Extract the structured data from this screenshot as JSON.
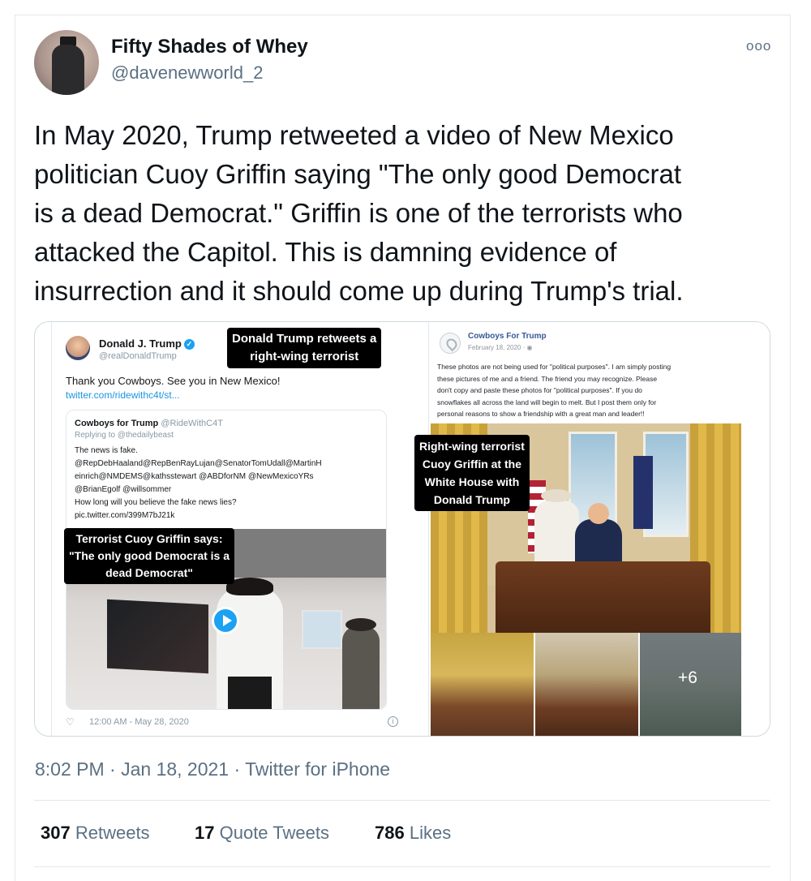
{
  "tweet": {
    "author": {
      "display_name": "Fifty Shades of Whey",
      "handle": "@davenewworld_2",
      "avatar_icon": "avatar-photo"
    },
    "more_icon": "more-options-icon",
    "text_lines": [
      "In May 2020, Trump retweeted a video of New Mexico",
      "politician Cuoy Griffin saying \"The only good Democrat",
      "is a dead Democrat.\" Griffin is one of the terrorists who",
      "attacked the Capitol. This is damning evidence of",
      "insurrection and it should come up during Trump's trial."
    ],
    "timestamp": "8:02 PM · Jan 18, 2021 · Twitter for iPhone",
    "stats": {
      "retweets": "307",
      "retweets_label": "Retweets",
      "quotes": "17",
      "quotes_label": "Quote Tweets",
      "likes": "786",
      "likes_label": "Likes"
    }
  },
  "media_left": {
    "name": "Donald J. Trump",
    "verified_mark": "✓",
    "handle": "@realDonaldTrump",
    "text": "Thank you Cowboys. See you in New Mexico!",
    "link": "twitter.com/ridewithc4t/st...",
    "quoted": {
      "name": "Cowboys for Trump",
      "handle": "@RideWithC4T",
      "replying": "Replying to @thedailybeast",
      "lines": [
        "The news is fake.",
        "@RepDebHaaland@RepBenRayLujan@SenatorTomUdall@MartinH",
        "einrich@NMDEMS@kathsstewart @ABDforNM @NewMexicoYRs",
        "@BrianEgolf @willsommer",
        "How long will you believe the fake news lies?",
        "pic.twitter.com/399M7bJ21k"
      ]
    },
    "heart_glyph": "♡",
    "info_glyph": "i",
    "time": "12:00 AM - May 28, 2020"
  },
  "media_right": {
    "page_name": "Cowboys For Trump",
    "date": "February 18, 2020 · ",
    "globe_glyph": "◉",
    "lines": [
      "These photos are not being used for \"political purposes\". I am simply posting",
      "these pictures of me and a friend. The friend you may recognize. Please",
      "don't copy and paste these photos for \"political purposes\". If you do",
      "snowflakes all across the land will begin to melt. But I post them only for",
      "personal reasons to show a friendship with a great man and leader!!"
    ],
    "more_photos": "+6"
  },
  "callouts": {
    "top": [
      "Donald Trump retweets a",
      "right-wing terrorist"
    ],
    "quote": [
      "Terrorist Cuoy Griffin says:",
      "\"The only good Democrat is a",
      "dead Democrat\""
    ],
    "photo": [
      "Right-wing terrorist",
      "Cuoy Griffin at the",
      "White House with",
      "Donald Trump"
    ]
  }
}
